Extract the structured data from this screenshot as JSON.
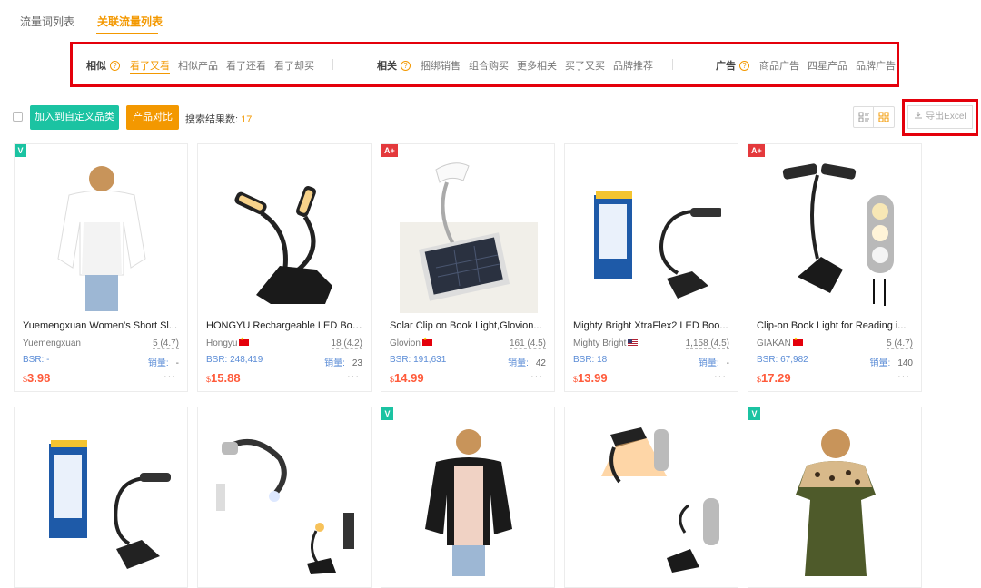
{
  "tabs": [
    "流量词列表",
    "关联流量列表"
  ],
  "filters": {
    "similar": {
      "title": "相似",
      "options": [
        "看了又看",
        "相似产品",
        "看了还看",
        "看了却买"
      ]
    },
    "related": {
      "title": "相关",
      "options": [
        "捆绑销售",
        "组合购买",
        "更多相关",
        "买了又买",
        "品牌推荐"
      ]
    },
    "ads": {
      "title": "广告",
      "options": [
        "商品广告",
        "四星产品",
        "品牌广告"
      ]
    },
    "help_glyph": "?"
  },
  "toolbar": {
    "add_category_label": "加入到自定义品类",
    "compare_label": "产品对比",
    "result_label": "搜索结果数:",
    "result_count": "17",
    "export_label": "导出Excel"
  },
  "products": [
    {
      "badge": "V",
      "title": "Yuemengxuan Women's Short Sl...",
      "brand": "Yuemengxuan",
      "flag": "",
      "rating": "5 (4.7)",
      "bsr": "BSR: -",
      "sales_label": "销量:",
      "sales": "-",
      "currency": "$",
      "price": "3.98",
      "image": "blouse-white"
    },
    {
      "badge": "",
      "title": "HONGYU Rechargeable LED Boo...",
      "brand": "Hongyu",
      "flag": "cn",
      "rating": "18 (4.2)",
      "bsr": "BSR: 248,419",
      "sales_label": "销量:",
      "sales": "23",
      "currency": "$",
      "price": "15.88",
      "image": "dual-lamp"
    },
    {
      "badge": "A+",
      "title": "Solar Clip on Book Light,Glovion...",
      "brand": "Glovion",
      "flag": "cn",
      "rating": "161 (4.5)",
      "bsr": "BSR: 191,631",
      "sales_label": "销量:",
      "sales": "42",
      "currency": "$",
      "price": "14.99",
      "image": "solar-lamp"
    },
    {
      "badge": "",
      "title": "Mighty Bright XtraFlex2 LED Boo...",
      "brand": "Mighty Bright",
      "flag": "us",
      "rating": "1,158 (4.5)",
      "bsr": "BSR: 18",
      "sales_label": "销量:",
      "sales": "-",
      "currency": "$",
      "price": "13.99",
      "image": "xtraflex"
    },
    {
      "badge": "A+",
      "title": "Clip-on Book Light for Reading i...",
      "brand": "GIAKAN",
      "flag": "cn",
      "rating": "5 (4.7)",
      "bsr": "BSR: 67,982",
      "sales_label": "销量:",
      "sales": "140",
      "currency": "$",
      "price": "17.29",
      "image": "dual-lamp-modes"
    },
    {
      "badge": "",
      "image": "xtraflex"
    },
    {
      "badge": "",
      "image": "neck-light"
    },
    {
      "badge": "V",
      "image": "cardigan-black"
    },
    {
      "badge": "",
      "image": "clip-lamp-orange"
    },
    {
      "badge": "V",
      "image": "dress-leopard"
    }
  ],
  "colors": {
    "accent": "#f39800",
    "teal": "#1bc3a2",
    "highlight": "#e4000b",
    "price": "#ff5b3b"
  }
}
